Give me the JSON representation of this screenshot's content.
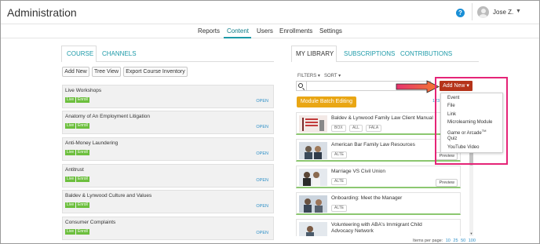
{
  "app_title": "Administration",
  "user": {
    "name": "Jose Z."
  },
  "nav": {
    "items": [
      "Reports",
      "Content",
      "Users",
      "Enrollments",
      "Settings"
    ],
    "active": "Content"
  },
  "left_panel": {
    "tabs": [
      "COURSE",
      "CHANNELS"
    ],
    "buttons": [
      "Add New",
      "Tree View",
      "Export Course Inventory"
    ],
    "courses": [
      {
        "name": "Live Workshops",
        "badges": [
          "Live",
          "Enroll"
        ],
        "action": "OPEN"
      },
      {
        "name": "Anatomy of An Employment Litigation",
        "badges": [
          "Live",
          "Enroll"
        ],
        "action": "OPEN"
      },
      {
        "name": "Anti-Money Laundering",
        "badges": [
          "Live",
          "Enroll"
        ],
        "action": "OPEN"
      },
      {
        "name": "Antitrust",
        "badges": [
          "Live",
          "Enroll"
        ],
        "action": "OPEN"
      },
      {
        "name": "Baldev & Lynwood Culture and Values",
        "badges": [
          "Live",
          "Enroll"
        ],
        "action": "OPEN"
      },
      {
        "name": "Consumer Complaints",
        "badges": [
          "Live",
          "Enroll"
        ],
        "action": "OPEN"
      }
    ]
  },
  "right_panel": {
    "tabs": [
      "MY LIBRARY",
      "SUBSCRIPTIONS",
      "CONTRIBUTIONS"
    ],
    "filters_label": "FILTERS",
    "sort_label": "SORT",
    "search_value": "",
    "module_batch_label": "Module Batch Editing",
    "count_label": "123",
    "add_new_label": "Add New",
    "add_new_menu": [
      "Event",
      "File",
      "Link",
      "Microlearning Module",
      "Game or Arcade",
      "Quiz",
      "YouTube Video"
    ],
    "add_new_menu_sup": "TM",
    "library_items": [
      {
        "title": "Baldev & Lynwood Family Law Client Manual",
        "tags": [
          "BOX",
          "ALL",
          "FALA"
        ],
        "preview": ""
      },
      {
        "title": "American Bar Family Law Resources",
        "tags": [
          "ALTE"
        ],
        "preview": "Preview"
      },
      {
        "title": "Marriage VS Civil Union",
        "tags": [
          "ALTE"
        ],
        "preview": "Preview"
      },
      {
        "title": "Onboarding: Meet the Manager",
        "tags": [
          "ALTE"
        ],
        "preview": ""
      },
      {
        "title": "Volunteering with ABA's Immigrant Child",
        "title2": "Advocacy Network",
        "tags": [],
        "preview": ""
      }
    ],
    "pager": {
      "label": "Items per page:",
      "options": [
        "10",
        "25",
        "50",
        "100"
      ]
    }
  },
  "colors": {
    "accent": "#1d9aa8",
    "live_badge": "#6cbf3d",
    "add_new": "#b5341a",
    "module_btn": "#e9a614",
    "highlight": "#e52477",
    "arrow": "#e8336f"
  }
}
